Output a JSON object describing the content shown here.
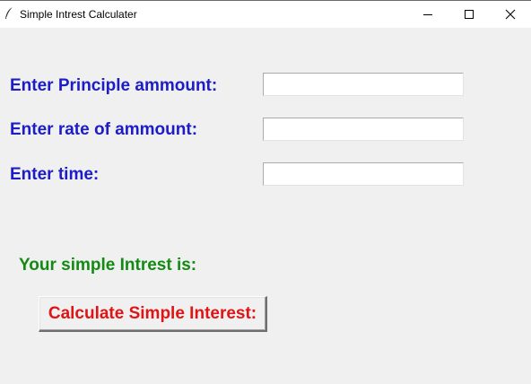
{
  "window": {
    "title": "Simple Intrest Calculater"
  },
  "form": {
    "principle_label": "Enter Principle ammount:",
    "principle_value": "",
    "rate_label": "Enter rate of ammount:",
    "rate_value": "",
    "time_label": "Enter time:",
    "time_value": ""
  },
  "result": {
    "label": "Your simple Intrest is:"
  },
  "actions": {
    "calculate_label": "Calculate Simple Interest:"
  },
  "colors": {
    "label_blue": "#1c1cc8",
    "result_green": "#138a13",
    "button_red": "#e01414",
    "background": "#f0f0f0"
  },
  "icons": {
    "app": "feather-icon",
    "minimize": "minimize-icon",
    "maximize": "maximize-icon",
    "close": "close-icon"
  }
}
